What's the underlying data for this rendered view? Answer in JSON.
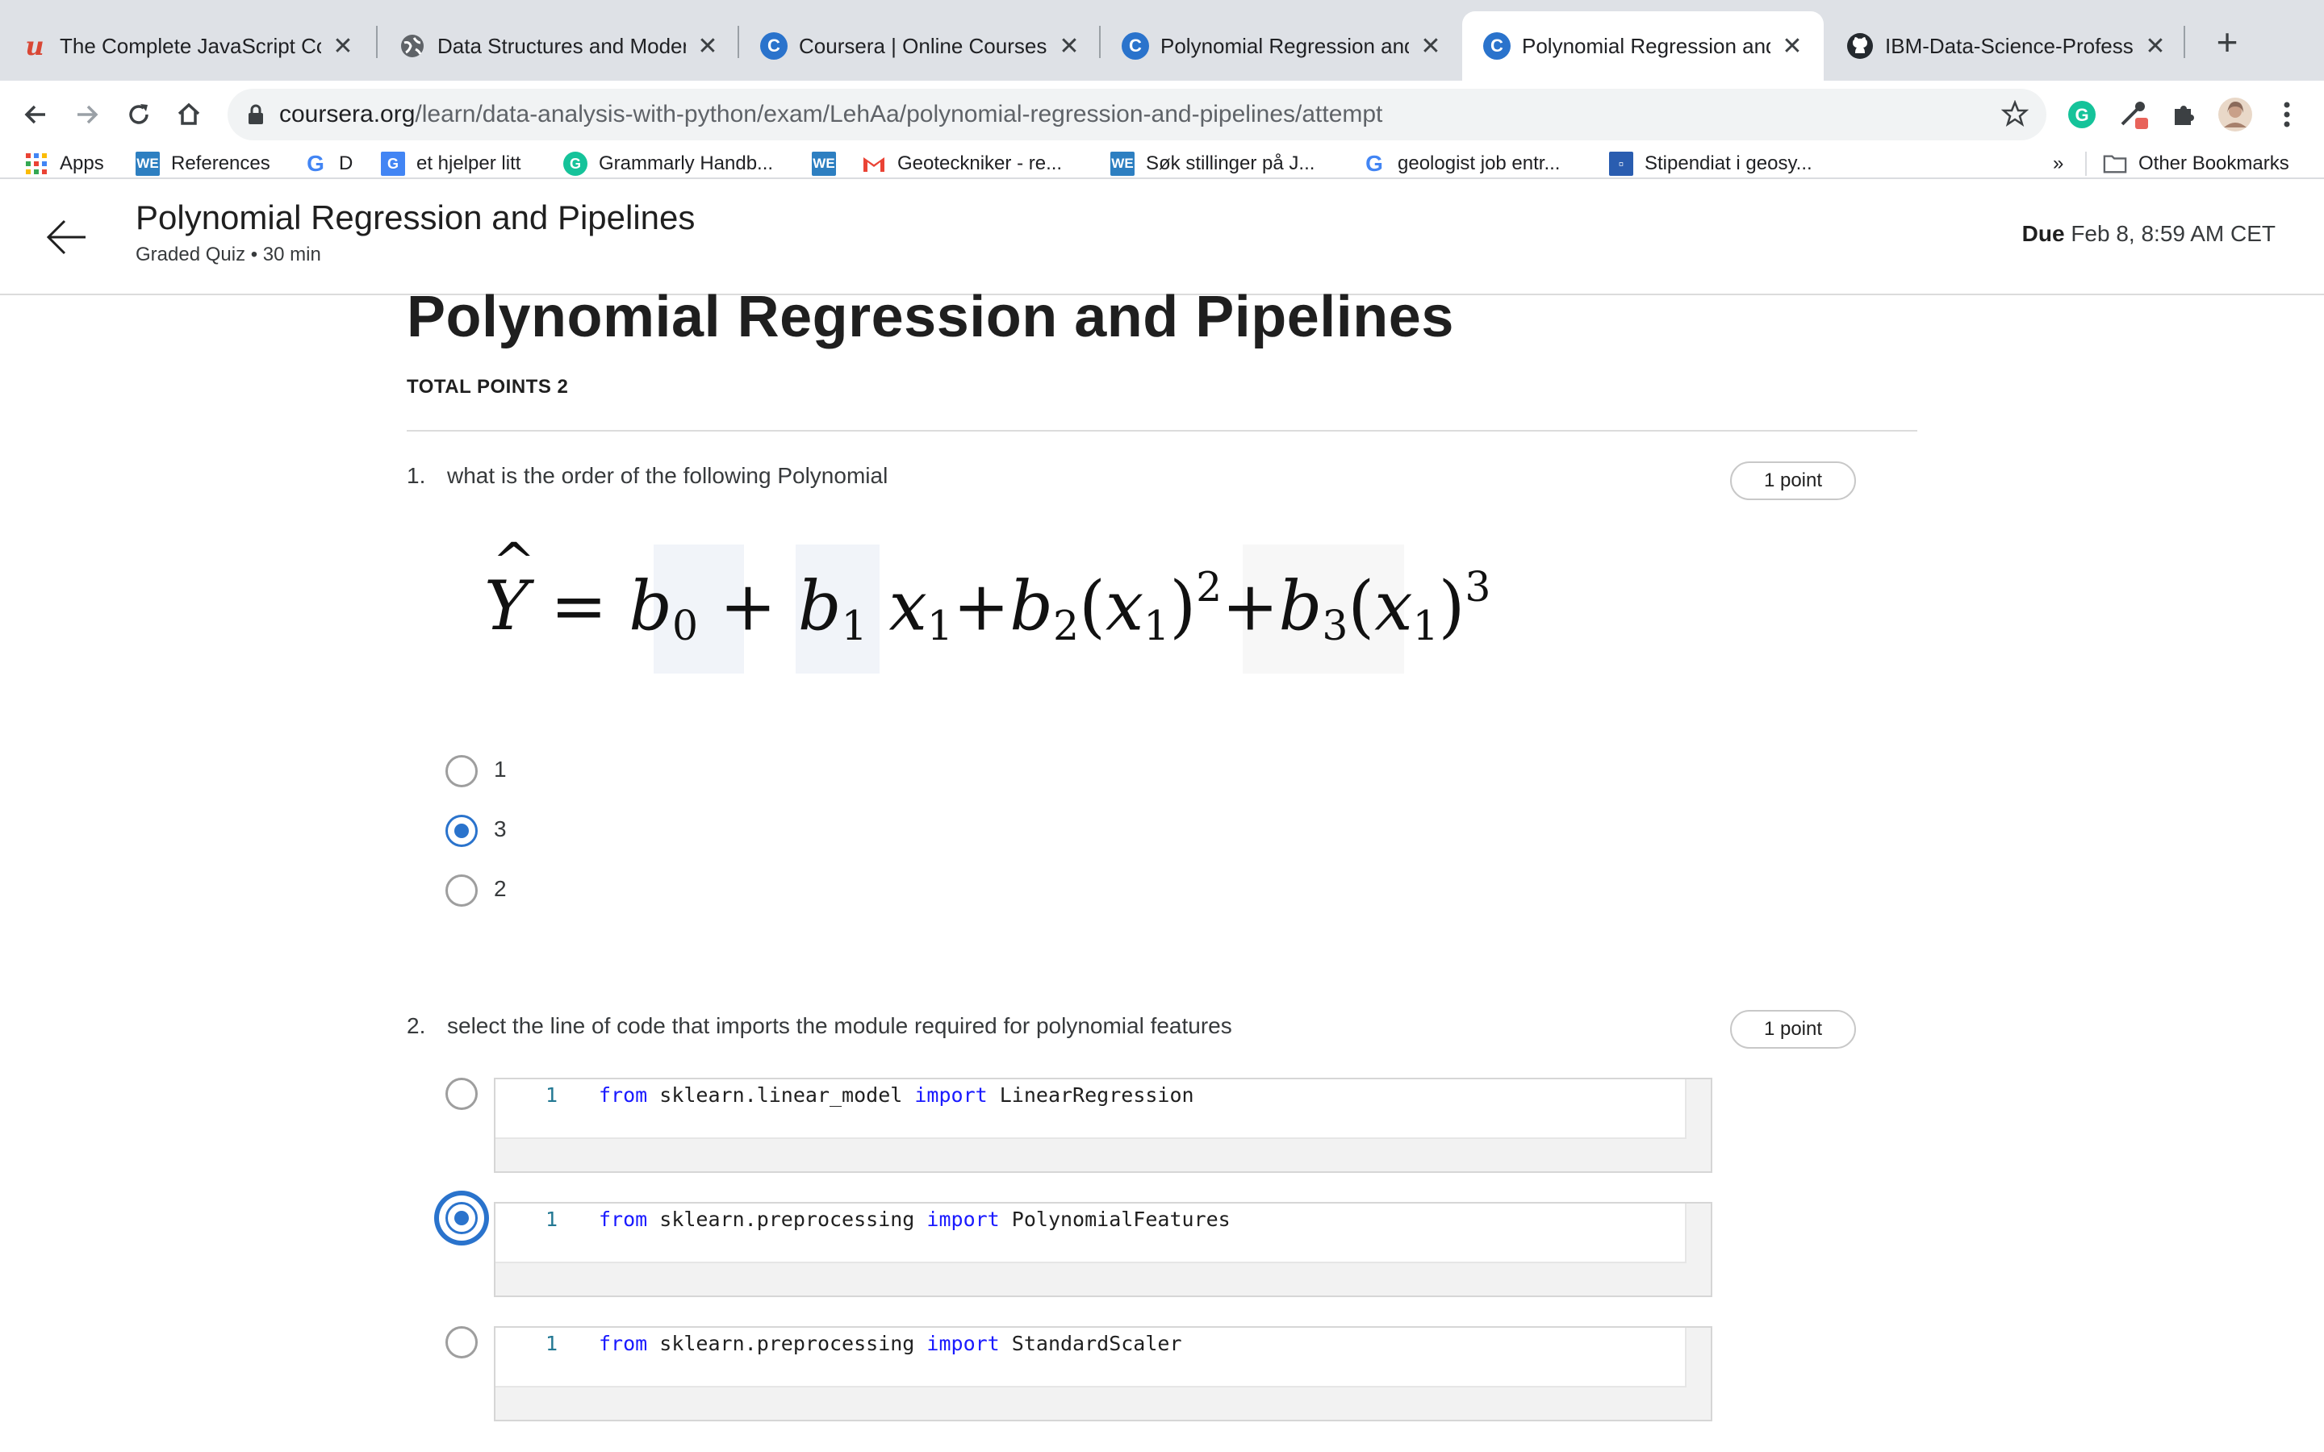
{
  "browser": {
    "tabs": [
      {
        "title": "The Complete JavaScript Co",
        "icon": "udemy-icon",
        "active": false
      },
      {
        "title": "Data Structures and Modern",
        "icon": "globe-icon",
        "active": false
      },
      {
        "title": "Coursera | Online Courses &",
        "icon": "coursera-icon",
        "active": false
      },
      {
        "title": "Polynomial Regression and P",
        "icon": "coursera-icon",
        "active": false
      },
      {
        "title": "Polynomial Regression and P",
        "icon": "coursera-icon",
        "active": true
      },
      {
        "title": "IBM-Data-Science-Professio",
        "icon": "github-icon",
        "active": false
      }
    ],
    "url_host": "coursera.org",
    "url_path": "/learn/data-analysis-with-python/exam/LehAa/polynomial-regression-and-pipelines/attempt",
    "bookmarks": [
      {
        "label": "Apps",
        "icon": "apps-grid-icon"
      },
      {
        "label": "References",
        "icon": "we-icon"
      },
      {
        "label": "D",
        "icon": "google-icon"
      },
      {
        "label": "et hjelper litt",
        "icon": "google-translate-icon"
      },
      {
        "label": "Grammarly Handb...",
        "icon": "grammarly-icon"
      },
      {
        "label": "",
        "icon": "we-icon"
      },
      {
        "label": "Geoteckniker - re...",
        "icon": "gmail-icon"
      },
      {
        "label": "Søk stillinger på J...",
        "icon": "we-icon"
      },
      {
        "label": "geologist job entr...",
        "icon": "google-icon"
      },
      {
        "label": "Stipendiat i geosy...",
        "icon": "bookmark-square-icon"
      }
    ],
    "overflow_label": "»",
    "other_bookmarks": "Other Bookmarks"
  },
  "header": {
    "title": "Polynomial Regression and Pipelines",
    "subtitle": "Graded Quiz • 30 min",
    "due_label": "Due",
    "due_value": "Feb 8, 8:59 AM CET"
  },
  "quiz": {
    "title": "Polynomial Regression and Pipelines",
    "total_points": "TOTAL POINTS 2",
    "questions": [
      {
        "number": "1.",
        "text": "what is the order of the following Polynomial",
        "points": "1 point",
        "options": [
          "1",
          "3",
          "2"
        ],
        "selected_index": 1
      },
      {
        "number": "2.",
        "text": "select the line of code that imports the module  required for polynomial features",
        "points": "1 point",
        "options": [
          {
            "line": "1",
            "kw1": "from",
            "module": "sklearn.linear_model",
            "kw2": "import",
            "name": "LinearRegression"
          },
          {
            "line": "1",
            "kw1": "from",
            "module": "sklearn.preprocessing",
            "kw2": "import",
            "name": "PolynomialFeatures"
          },
          {
            "line": "1",
            "kw1": "from",
            "module": "sklearn.preprocessing",
            "kw2": "import",
            "name": "StandardScaler"
          }
        ],
        "selected_index": 1
      }
    ]
  },
  "colors": {
    "accent": "#2a73cc",
    "code_keyword": "#1a1aff",
    "line_number": "#237893"
  }
}
